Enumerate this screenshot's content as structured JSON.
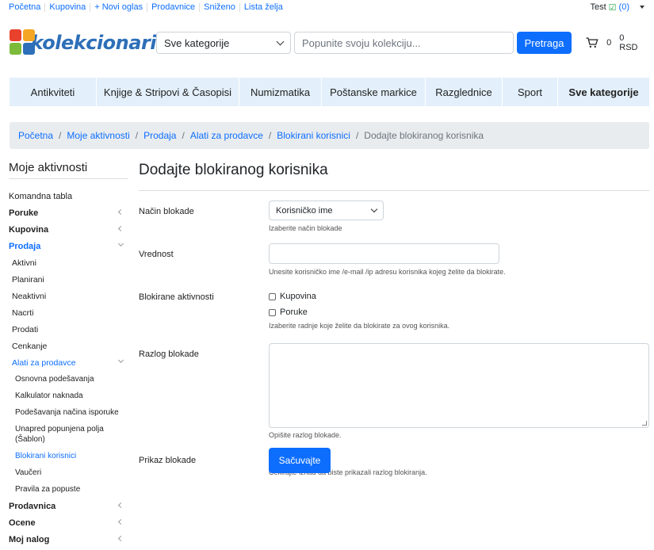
{
  "topbar": {
    "links": [
      "Početna",
      "Kupovina",
      "+ Novi oglas",
      "Prodavnice",
      "Sniženo",
      "Lista želja"
    ],
    "user": "Test",
    "msg_count": "(0)"
  },
  "header": {
    "logo_text": "kolekcionari",
    "category_select": "Sve kategorije",
    "search_placeholder": "Popunite svoju kolekciju...",
    "search_button": "Pretraga",
    "cart_count": "0",
    "cart_total": "0 RSD"
  },
  "nav": [
    "Antikviteti",
    "Knjige & Stripovi & Časopisi",
    "Numizmatika",
    "Poštanske markice",
    "Razglednice",
    "Sport",
    "Sve kategorije"
  ],
  "breadcrumb": [
    "Početna",
    "Moje aktivnosti",
    "Prodaja",
    "Alati za prodavce",
    "Blokirani korisnici"
  ],
  "breadcrumb_current": "Dodajte blokiranog korisnika",
  "sidebar": {
    "title": "Moje aktivnosti",
    "items": [
      {
        "label": "Komandna tabla"
      },
      {
        "label": "Poruke"
      },
      {
        "label": "Kupovina"
      },
      {
        "label": "Prodaja"
      },
      {
        "label": "Aktivni"
      },
      {
        "label": "Planirani"
      },
      {
        "label": "Neaktivni"
      },
      {
        "label": "Nacrti"
      },
      {
        "label": "Prodati"
      },
      {
        "label": "Cenkanje"
      },
      {
        "label": "Alati za prodavce"
      },
      {
        "label": "Osnovna podešavanja"
      },
      {
        "label": "Kalkulator naknada"
      },
      {
        "label": "Podešavanja načina isporuke"
      },
      {
        "label": "Unapred popunjena polja (Šablon)"
      },
      {
        "label": "Blokirani korisnici"
      },
      {
        "label": "Vaučeri"
      },
      {
        "label": "Pravila za popuste"
      },
      {
        "label": "Prodavnica"
      },
      {
        "label": "Ocene"
      },
      {
        "label": "Moj nalog"
      }
    ]
  },
  "form": {
    "title": "Dodajte blokiranog korisnika",
    "block_type_label": "Način blokade",
    "block_type_value": "Korisničko ime",
    "block_type_help": "Izaberite način blokade",
    "value_label": "Vrednost",
    "value_help": "Unesite korisničko ime /e-mail /ip adresu korisnika kojeg želite da blokirate.",
    "activities_label": "Blokirane aktivnosti",
    "activity_1": "Kupovina",
    "activity_2": "Poruke",
    "activities_help": "Izaberite radnje koje želite da blokirate za ovog korisnika.",
    "reason_label": "Razlog blokade",
    "reason_help": "Opišite razlog blokade.",
    "display_label": "Prikaz blokade",
    "display_help": "Čekirajte iznad da biste prikazali razlog blokiranja.",
    "save_button": "Sačuvajte"
  },
  "colors": {
    "primary": "#0d6efd",
    "nav_bg": "#e3f0fb",
    "crumb_bg": "#e9ecef"
  }
}
